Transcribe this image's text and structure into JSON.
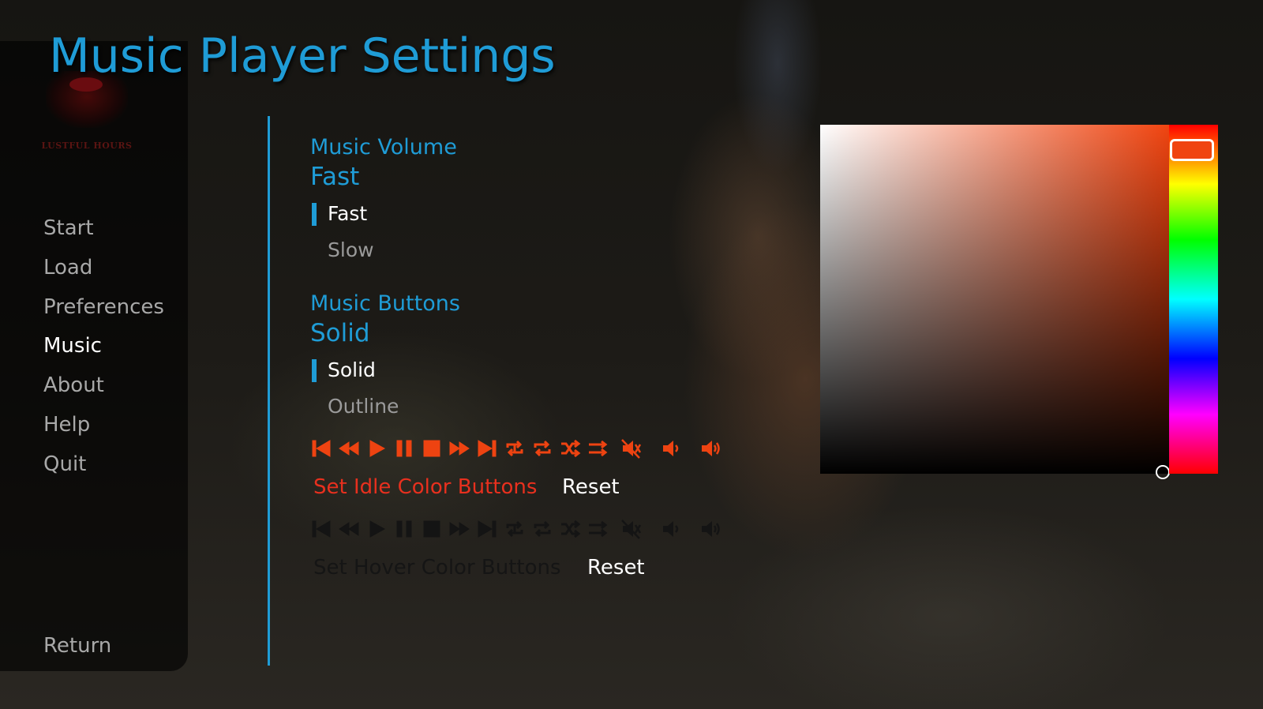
{
  "title": "Music Player Settings",
  "logo": {
    "text": "LUSTFUL HOURS"
  },
  "nav": {
    "items": [
      "Start",
      "Load",
      "Preferences",
      "Music",
      "About",
      "Help",
      "Quit"
    ],
    "active": "Music",
    "return_label": "Return"
  },
  "music_volume": {
    "label": "Music Volume",
    "current": "Fast",
    "options": [
      "Fast",
      "Slow"
    ],
    "selected": "Fast"
  },
  "music_buttons": {
    "label": "Music Buttons",
    "current": "Solid",
    "options": [
      "Solid",
      "Outline"
    ],
    "selected": "Solid"
  },
  "player_icons": [
    "skip-start-icon",
    "rewind-icon",
    "play-icon",
    "pause-icon",
    "stop-icon",
    "fast-forward-icon",
    "skip-end-icon",
    "repeat-one-icon",
    "repeat-icon",
    "shuffle-icon",
    "sequential-icon",
    "mute-icon",
    "volume-low-icon",
    "volume-high-icon"
  ],
  "idle": {
    "set_label": "Set Idle Color Buttons",
    "reset_label": "Reset",
    "color": "#ee4311"
  },
  "hover": {
    "set_label": "Set Hover Color Buttons",
    "reset_label": "Reset",
    "color": "#141414"
  },
  "colors": {
    "accent": "#1f9cd6",
    "picker_hue": "#f04410",
    "idle_label": "#e8301e",
    "nav_idle": "#a8a8a8",
    "nav_active": "#ffffff"
  }
}
